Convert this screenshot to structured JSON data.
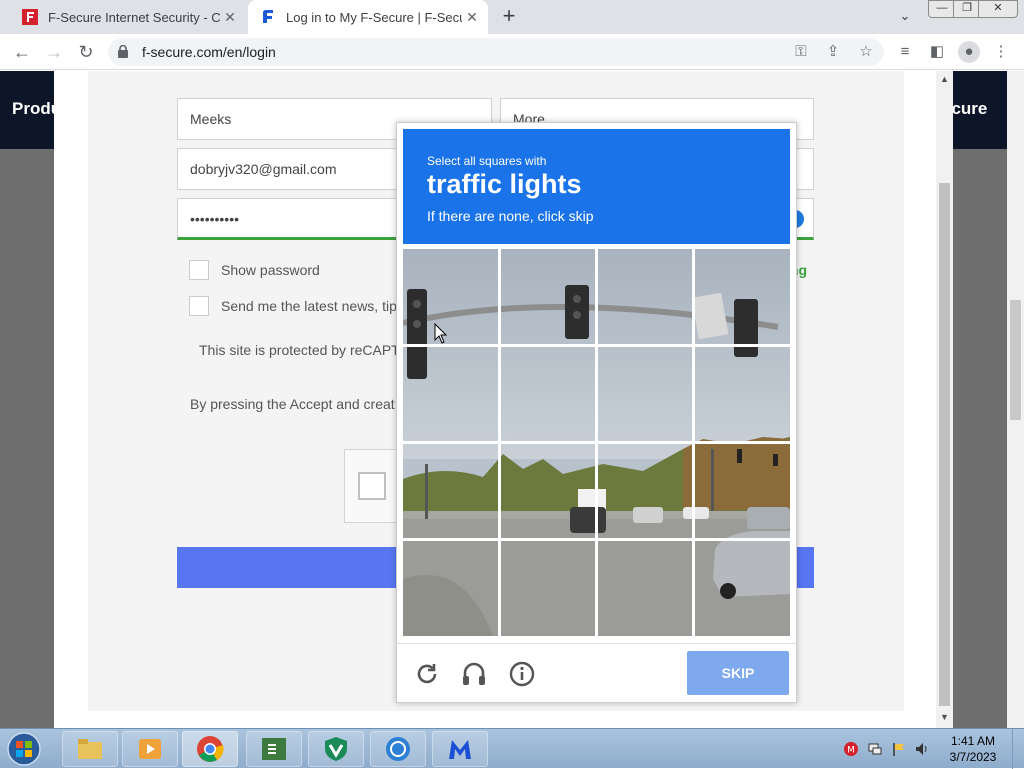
{
  "browser": {
    "tabs": [
      {
        "title": "F-Secure Internet Security - Скач",
        "active": false
      },
      {
        "title": "Log in to My F-Secure | F-Secure",
        "active": true
      }
    ],
    "new_tab": "+",
    "url": "f-secure.com/en/login",
    "window_controls": {
      "minimize": "—",
      "maximize": "❐",
      "close": "✕"
    }
  },
  "site": {
    "nav_left": "Produ",
    "nav_right": "ecure"
  },
  "form": {
    "first_name": "Meeks",
    "last_name": "More",
    "email": "dobryjv320@gmail.com",
    "password": "••••••••••",
    "show_password": "Show password",
    "password_strength": "ng",
    "newsletter": "Send me the latest news, tip",
    "protected": "This site is protected by reCAPT",
    "accept": "By pressing the Accept and creat",
    "terms_link": "s"
  },
  "captcha": {
    "instruction": "Select all squares with",
    "target": "traffic lights",
    "hint": "If there are none, click skip",
    "skip_label": "SKIP",
    "icons": [
      "reload-icon",
      "headphones-icon",
      "info-icon"
    ]
  },
  "taskbar": {
    "apps": [
      "explorer",
      "media-player",
      "chrome",
      "csharp-editor",
      "shield-app",
      "skype",
      "malwarebytes"
    ],
    "time": "1:41 AM",
    "date": "3/7/2023"
  }
}
